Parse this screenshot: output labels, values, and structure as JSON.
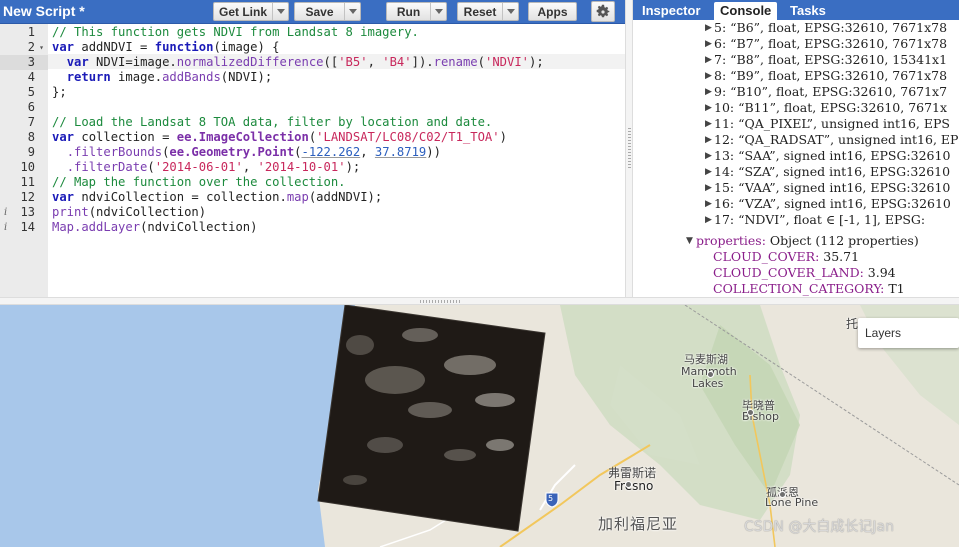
{
  "editor": {
    "script_title": "New Script *",
    "buttons": {
      "get_link": "Get Link",
      "save": "Save",
      "run": "Run",
      "reset": "Reset",
      "apps": "Apps"
    },
    "icons": {
      "settings": "gear-icon",
      "dropdown": "chevron-down-icon",
      "info": "info-icon",
      "fold": "fold-arrow-icon"
    },
    "line_numbers": [
      "1",
      "2",
      "3",
      "4",
      "5",
      "6",
      "7",
      "8",
      "9",
      "10",
      "11",
      "12",
      "13",
      "14"
    ],
    "active_line": "3",
    "code": {
      "l1_comment": "// This function gets NDVI from Landsat 8 imagery.",
      "l2_var": "var",
      "l2_name": " addNDVI = ",
      "l2_function": "function",
      "l2_rest": "(image) {",
      "l3_var": "var",
      "l3_a": " NDVI=image.",
      "l3_method": "normalizedDifference",
      "l3_b": "([",
      "l3_s1": "'B5'",
      "l3_c": ", ",
      "l3_s2": "'B4'",
      "l3_d": "]).",
      "l3_method2": "rename",
      "l3_e": "(",
      "l3_s3": "'NDVI'",
      "l3_f": ");",
      "l4_return": "return",
      "l4_a": " image.",
      "l4_method": "addBands",
      "l4_b": "(NDVI);",
      "l5": "};",
      "l7_comment": "// Load the Landsat 8 TOA data, filter by location and date.",
      "l8_var": "var",
      "l8_a": " collection = ",
      "l8_api": "ee.ImageCollection",
      "l8_b": "(",
      "l8_s": "'LANDSAT/LC08/C02/T1_TOA'",
      "l8_c": ")",
      "l9_method": ".filterBounds",
      "l9_a": "(",
      "l9_api": "ee.Geometry.Point",
      "l9_b": "(",
      "l9_n1": "-122.262",
      "l9_c": ", ",
      "l9_n2": "37.8719",
      "l9_d": "))",
      "l10_method": ".filterDate",
      "l10_a": "(",
      "l10_s1": "'2014-06-01'",
      "l10_b": ", ",
      "l10_s2": "'2014-10-01'",
      "l10_c": ");",
      "l11_comment": "// Map the function over the collection.",
      "l12_var": "var",
      "l12_a": " ndviCollection = collection.",
      "l12_method": "map",
      "l12_b": "(addNDVI);",
      "l13_fn": "print",
      "l13_a": "(ndviCollection)",
      "l14_fn": "Map.addLayer",
      "l14_a": "(ndviCollection)"
    }
  },
  "right_panel": {
    "tabs": [
      "Inspector",
      "Console",
      "Tasks"
    ],
    "active_tab": "Console",
    "bands": [
      "5: “B6”, float, EPSG:32610, 7671x78",
      "6: “B7”, float, EPSG:32610, 7671x78",
      "7: “B8”, float, EPSG:32610, 15341x1",
      "8: “B9”, float, EPSG:32610, 7671x78",
      "9: “B10”, float, EPSG:32610, 7671x7",
      "10: “B11”, float, EPSG:32610, 7671x",
      "11: “QA_PIXEL”, unsigned int16, EPS",
      "12: “QA_RADSAT”, unsigned int16, EP",
      "13: “SAA”, signed int16, EPSG:32610",
      "14: “SZA”, signed int16, EPSG:32610",
      "15: “VAA”, signed int16, EPSG:32610",
      "16: “VZA”, signed int16, EPSG:32610",
      "17: “NDVI”, float ∈ [-1, 1], EPSG:"
    ],
    "properties_key": "properties:",
    "properties_val": " Object (112 properties)",
    "props": [
      {
        "key": "CLOUD_COVER:",
        "val": " 35.71"
      },
      {
        "key": "CLOUD_COVER_LAND:",
        "val": " 3.94"
      },
      {
        "key": "COLLECTION_CATEGORY:",
        "val": " T1"
      }
    ]
  },
  "map": {
    "layers_label": "Layers",
    "places": {
      "mammoth_cn": "马麦斯湖",
      "mammoth_en": "Mammoth",
      "lakes_en": "Lakes",
      "bishop_cn": "毕晓普",
      "bishop_en": "Bishop",
      "fresno_cn": "弗雷斯诺",
      "fresno_en": "Fresno",
      "lonepine_cn": "孤派恩",
      "lonepine_en": "Lone Pine",
      "california_cn": "加利福尼亚",
      "partial_cn": "托",
      "highway": "5"
    },
    "watermark": "CSDN @大白成长记Jan",
    "colors": {
      "ocean": "#a8c7ea",
      "land": "#eae6dc",
      "mountain": "#cfdcc2",
      "header_blue": "#3a6ec2"
    }
  }
}
